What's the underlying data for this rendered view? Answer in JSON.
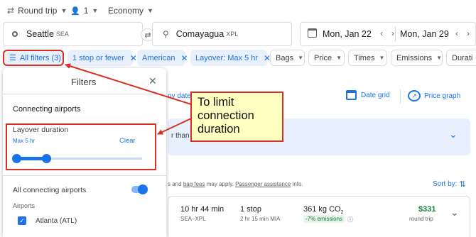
{
  "top": {
    "trip_type": "Round trip",
    "passengers": "1",
    "cabin": "Economy"
  },
  "search": {
    "origin": "Seattle",
    "origin_code": "SEA",
    "destination": "Comayagua",
    "destination_code": "XPL",
    "depart": "Mon, Jan 22",
    "return": "Mon, Jan 29"
  },
  "chips": [
    {
      "label": "All filters (3)",
      "selected": true
    },
    {
      "label": "1 stop or fewer",
      "selected": true
    },
    {
      "label": "American",
      "selected": true
    },
    {
      "label": "Layover: Max 5 hr",
      "selected": true
    },
    {
      "label": "Bags",
      "selected": false
    },
    {
      "label": "Price",
      "selected": false
    },
    {
      "label": "Times",
      "selected": false
    },
    {
      "label": "Emissions",
      "selected": false
    },
    {
      "label": "Durati",
      "selected": false
    }
  ],
  "filters": {
    "title": "Filters",
    "connecting_airports_heading": "Connecting airports",
    "layover_label": "Layover duration",
    "layover_value": "Max 5 hr",
    "clear_label": "Clear",
    "slider_value_fraction": 0.24,
    "all_connecting_label": "All connecting airports",
    "all_connecting_on": true,
    "airports_label": "Airports",
    "airport_1": "Atlanta (ATL)",
    "airport_1_checked": true
  },
  "behind": {
    "dates_fragment": "ny dates",
    "date_grid": "Date grid",
    "price_graph": "Price graph",
    "than_fragment": "r than u",
    "info_prefix": "s and",
    "bag_fees": "bag fees",
    "info_middle": "may apply.",
    "passenger_assistance": "Passenger assistance",
    "info_suffix": "info.",
    "sort_by": "Sort by:"
  },
  "result": {
    "duration": "10 hr 44 min",
    "route": "SEA–XPL",
    "stops": "1 stop",
    "layover": "2 hr 15 min MIA",
    "emissions_value": "361 kg CO",
    "emissions_sub": "2",
    "emissions_badge": "-7% emissions",
    "price": "$331",
    "price_note": "round trip"
  },
  "annotation": {
    "text": "To limit connection duration"
  },
  "colors": {
    "accent": "#1a73e8",
    "chip_bg": "#e8f0fe",
    "annotation_border": "#d93025",
    "annotation_bg": "#ffffc2",
    "price_green": "#188038"
  }
}
